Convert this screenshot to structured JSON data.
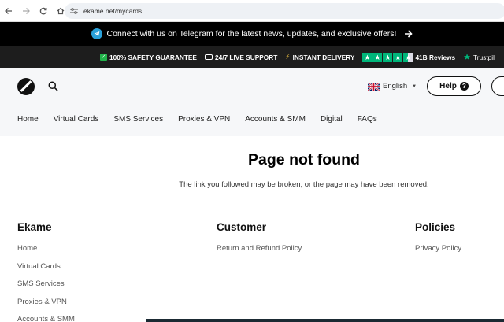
{
  "browser": {
    "url": "ekame.net/mycards"
  },
  "banner": {
    "text": "Connect with us on Telegram for the latest news, updates, and exclusive offers!"
  },
  "trust": {
    "safety": "100% SAFETY GUARANTEE",
    "support": "24/7 LIVE SUPPORT",
    "delivery": "INSTANT DELIVERY",
    "reviews": "41B Reviews",
    "trustpilot": "Trustpil"
  },
  "header": {
    "language": "English",
    "help_label": "Help"
  },
  "nav": {
    "items": [
      "Home",
      "Virtual Cards",
      "SMS Services",
      "Proxies & VPN",
      "Accounts & SMM",
      "Digital",
      "FAQs"
    ]
  },
  "content": {
    "title": "Page not found",
    "message": "The link you followed may be broken, or the page may have been removed."
  },
  "footer": {
    "col1": {
      "heading": "Ekame",
      "links": [
        "Home",
        "Virtual Cards",
        "SMS Services",
        "Proxies & VPN",
        "Accounts & SMM"
      ]
    },
    "col2": {
      "heading": "Customer",
      "links": [
        "Return and Refund Policy"
      ]
    },
    "col3": {
      "heading": "Policies",
      "links": [
        "Privacy Policy"
      ]
    }
  },
  "colors": {
    "telegram": "#2aa1da",
    "trustpilot": "#00b67a",
    "bar_dark": "#1d1d1d"
  }
}
